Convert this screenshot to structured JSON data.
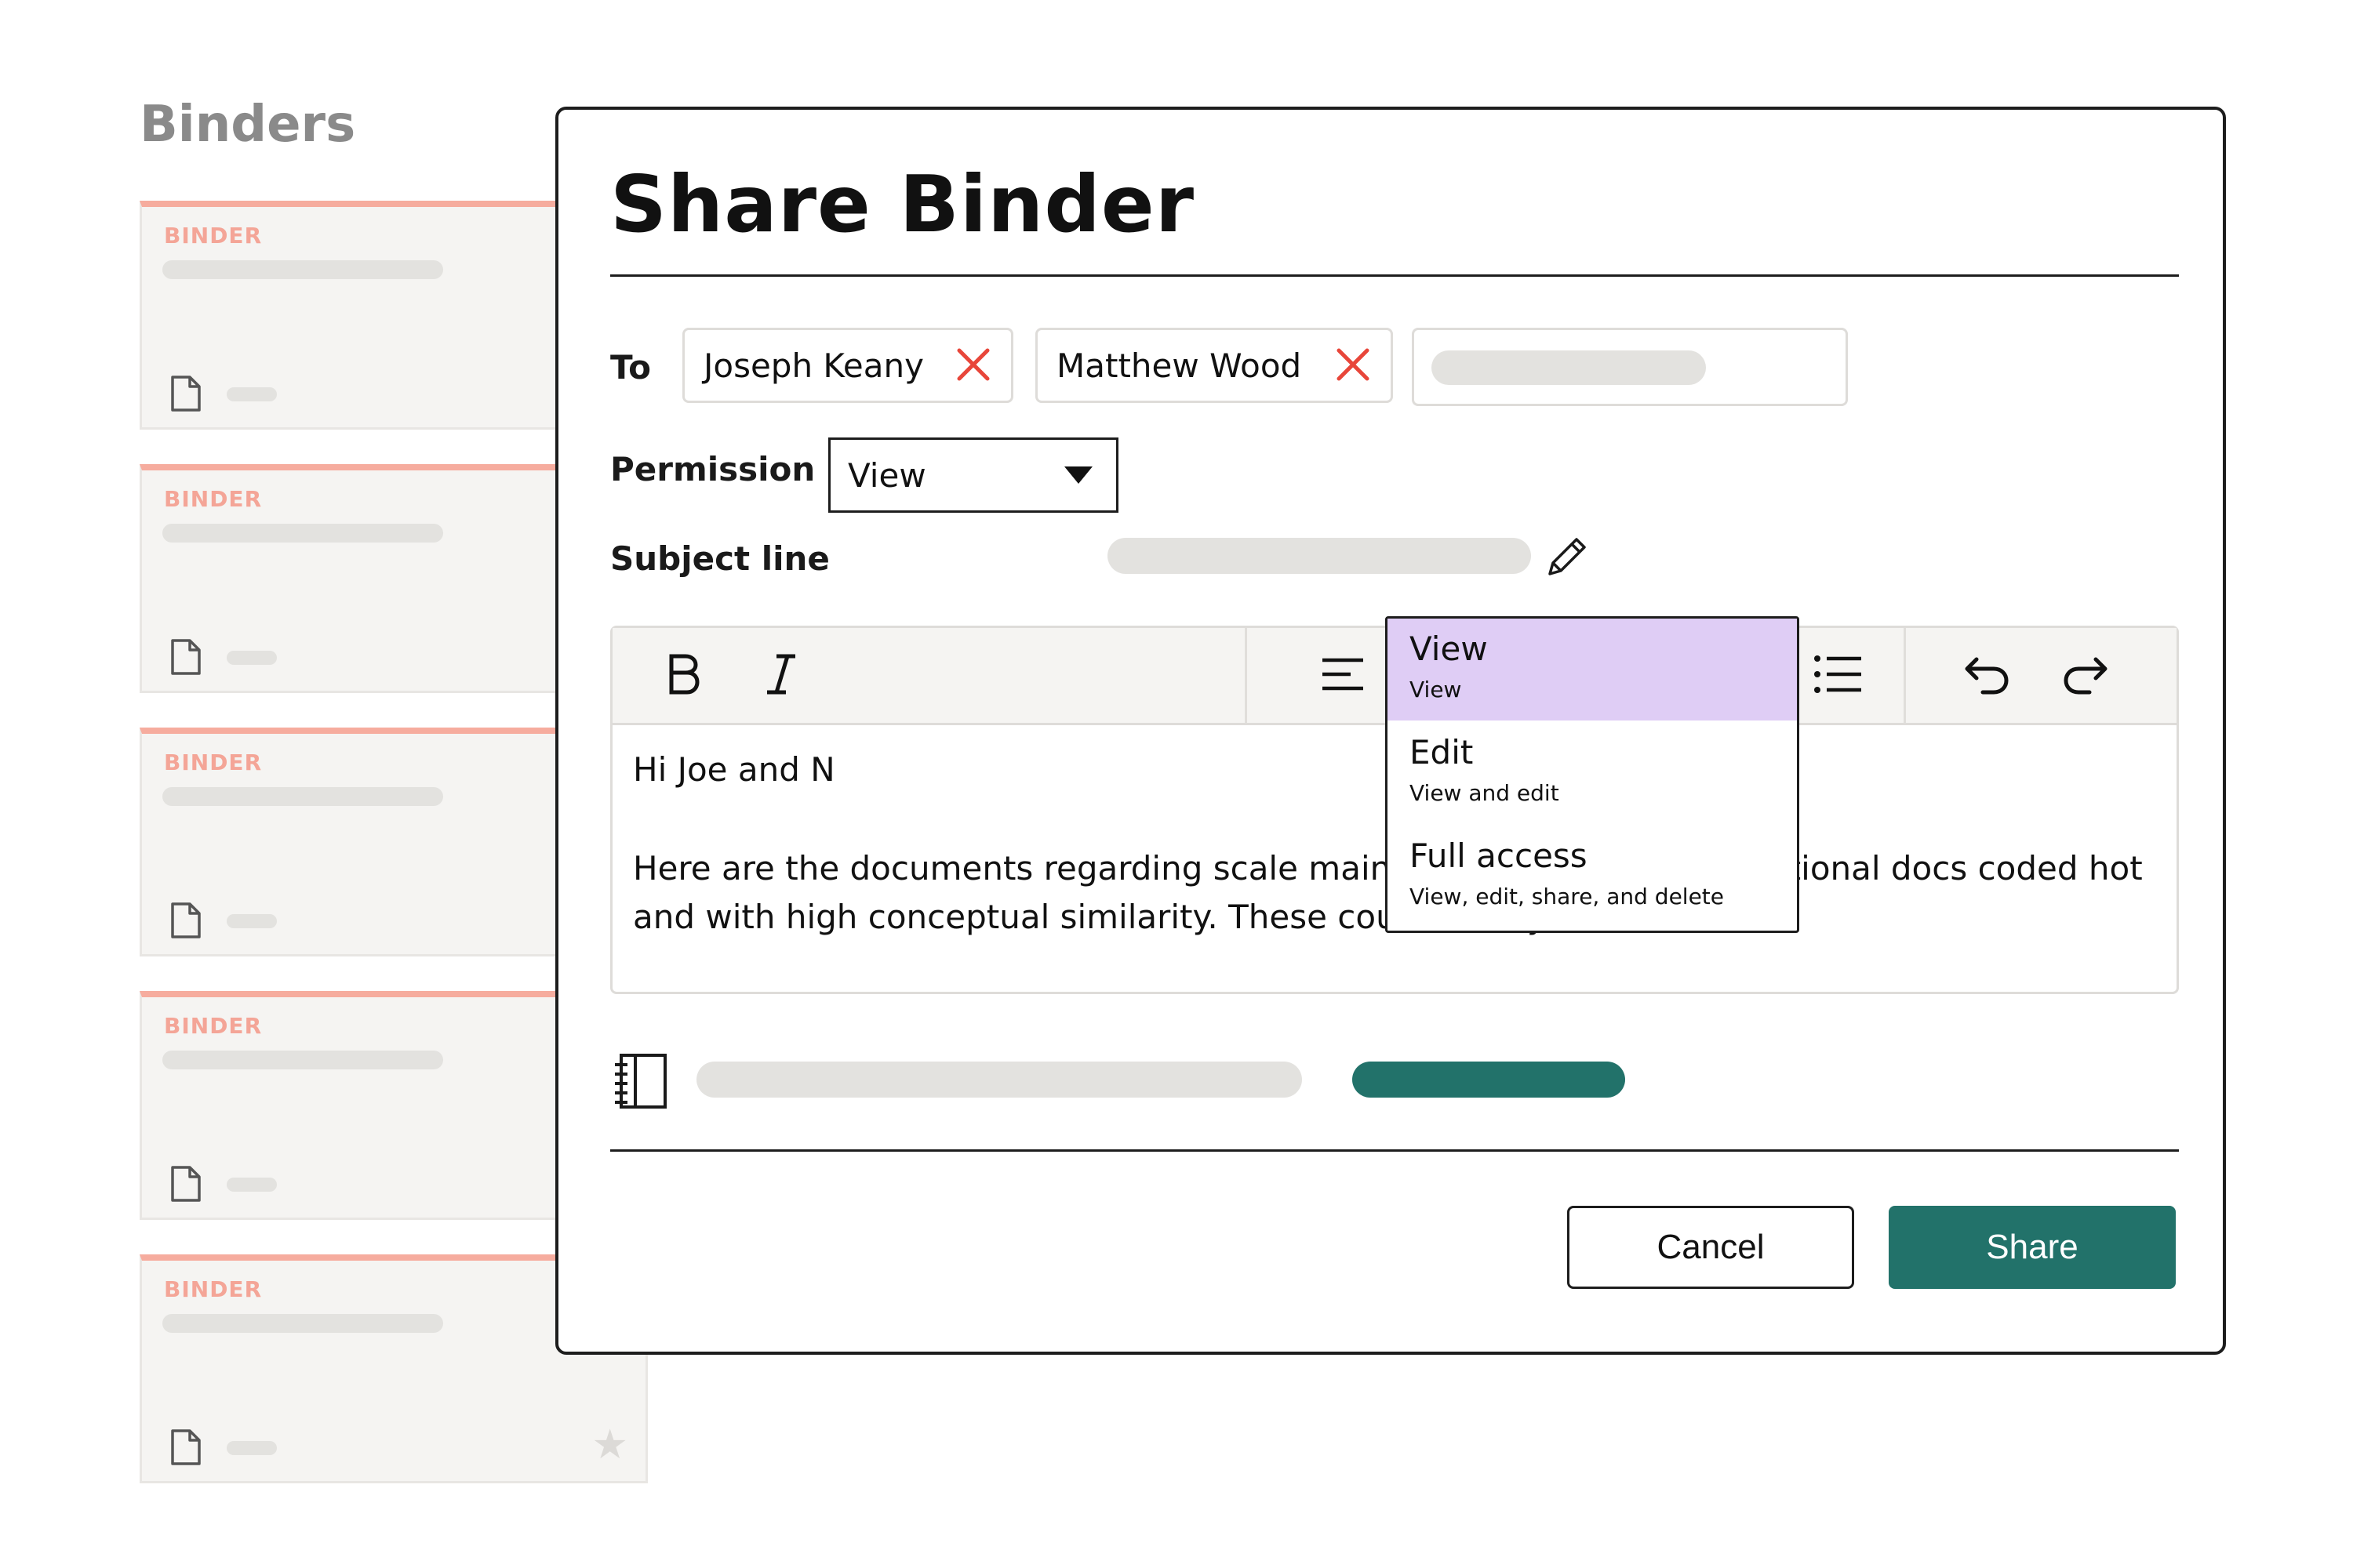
{
  "background_panel": {
    "title": "Binders",
    "cards": [
      {
        "label": "BINDER"
      },
      {
        "label": "BINDER"
      },
      {
        "label": "BINDER"
      },
      {
        "label": "BINDER"
      },
      {
        "label": "BINDER"
      }
    ]
  },
  "dialog": {
    "title": "Share Binder",
    "to_label": "To",
    "recipients": [
      {
        "name": "Joseph Keany"
      },
      {
        "name": "Matthew Wood"
      }
    ],
    "permission_label": "Permission",
    "permission_value": "View",
    "subject_label": "Subject line",
    "permission_options": [
      {
        "title": "View",
        "description": "View"
      },
      {
        "title": "Edit",
        "description": "View and edit"
      },
      {
        "title": "Full access",
        "description": "View, edit, share, and delete"
      }
    ],
    "selected_option": "View",
    "message": {
      "greeting": "Hi Joe and N",
      "body": "Here are the documents regarding scale maintenance, as well as additional docs coded hot and with high conceptual similarity. These could be key!"
    },
    "toolbar": [
      "bold-icon",
      "italic-icon",
      "align-left-icon",
      "quote-icon",
      "clear-format-icon",
      "ordered-list-icon",
      "unordered-list-icon",
      "undo-icon",
      "redo-icon"
    ],
    "cancel_label": "Cancel",
    "share_label": "Share"
  },
  "colors": {
    "accent_teal": "#22726a",
    "binder_label": "#f4a597",
    "selected_option_bg": "#dfcdf5",
    "remove_x": "#e8463a"
  }
}
